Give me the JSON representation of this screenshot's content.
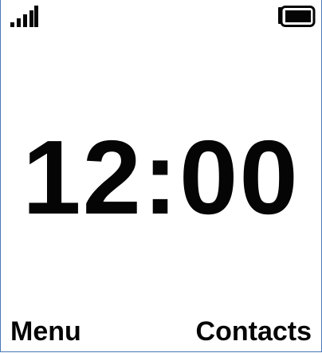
{
  "status_bar": {
    "signal_icon": "signal-strength-icon",
    "battery_icon": "battery-icon",
    "signal_level": 1.0,
    "battery_level": 1.0
  },
  "clock": {
    "time": "12:00"
  },
  "softkeys": {
    "left_label": "Menu",
    "right_label": "Contacts"
  },
  "colors": {
    "foreground": "#050505",
    "background": "#ffffff",
    "frame": "#4a78b6"
  }
}
